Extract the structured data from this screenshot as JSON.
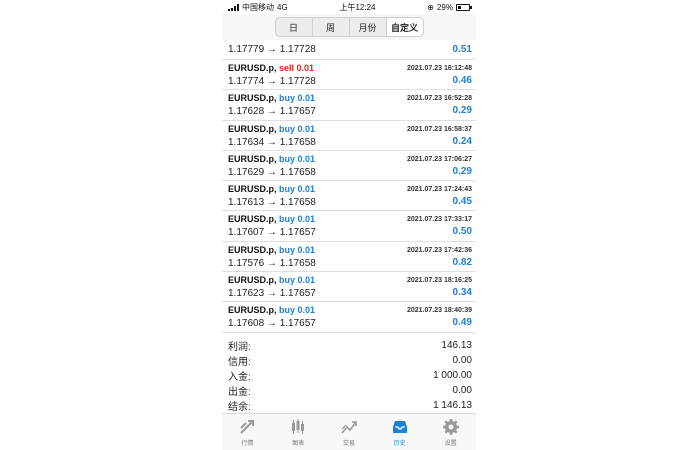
{
  "status_bar": {
    "carrier": "中国移动",
    "network": "4G",
    "time": "上午12:24",
    "battery": "29%",
    "battery_level": 0.29
  },
  "tabs": [
    {
      "label": "日",
      "active": false
    },
    {
      "label": "周",
      "active": false
    },
    {
      "label": "月份",
      "active": false
    },
    {
      "label": "自定义",
      "active": true
    }
  ],
  "partial_row": {
    "prices": "1.17779 → 1.17728",
    "profit": "0.51"
  },
  "trades": [
    {
      "symbol": "EURUSD.p,",
      "side": "sell 0.01",
      "type": "sell",
      "datetime": "2021.07.23 16:12:48",
      "prices": "1.17774 → 1.17728",
      "profit": "0.46"
    },
    {
      "symbol": "EURUSD.p,",
      "side": "buy 0.01",
      "type": "buy",
      "datetime": "2021.07.23 16:52:28",
      "prices": "1.17628 → 1.17657",
      "profit": "0.29"
    },
    {
      "symbol": "EURUSD.p,",
      "side": "buy 0.01",
      "type": "buy",
      "datetime": "2021.07.23 16:58:37",
      "prices": "1.17634 → 1.17658",
      "profit": "0.24"
    },
    {
      "symbol": "EURUSD.p,",
      "side": "buy 0.01",
      "type": "buy",
      "datetime": "2021.07.23 17:06:27",
      "prices": "1.17629 → 1.17658",
      "profit": "0.29"
    },
    {
      "symbol": "EURUSD.p,",
      "side": "buy 0.01",
      "type": "buy",
      "datetime": "2021.07.23 17:24:43",
      "prices": "1.17613 → 1.17658",
      "profit": "0.45"
    },
    {
      "symbol": "EURUSD.p,",
      "side": "buy 0.01",
      "type": "buy",
      "datetime": "2021.07.23 17:33:17",
      "prices": "1.17607 → 1.17657",
      "profit": "0.50"
    },
    {
      "symbol": "EURUSD.p,",
      "side": "buy 0.01",
      "type": "buy",
      "datetime": "2021.07.23 17:42:36",
      "prices": "1.17576 → 1.17658",
      "profit": "0.82"
    },
    {
      "symbol": "EURUSD.p,",
      "side": "buy 0.01",
      "type": "buy",
      "datetime": "2021.07.23 18:16:25",
      "prices": "1.17623 → 1.17657",
      "profit": "0.34"
    },
    {
      "symbol": "EURUSD.p,",
      "side": "buy 0.01",
      "type": "buy",
      "datetime": "2021.07.23 18:40:39",
      "prices": "1.17608 → 1.17657",
      "profit": "0.49"
    }
  ],
  "summary": [
    {
      "label": "利润:",
      "value": "146.13"
    },
    {
      "label": "信用:",
      "value": "0.00"
    },
    {
      "label": "入金:",
      "value": "1 000.00"
    },
    {
      "label": "出金:",
      "value": "0.00"
    },
    {
      "label": "结余:",
      "value": "1 146.13"
    }
  ],
  "bottom_nav": [
    {
      "label": "行情",
      "icon": "quotes-icon",
      "active": false
    },
    {
      "label": "图表",
      "icon": "chart-icon",
      "active": false
    },
    {
      "label": "交易",
      "icon": "trade-icon",
      "active": false
    },
    {
      "label": "历史",
      "icon": "history-icon",
      "active": true
    },
    {
      "label": "设置",
      "icon": "settings-icon",
      "active": false
    }
  ],
  "colors": {
    "sell": "#d9261c",
    "buy": "#1e7fd6",
    "profit": "#1e7fd6",
    "active_tab": "#1e7fd6"
  }
}
